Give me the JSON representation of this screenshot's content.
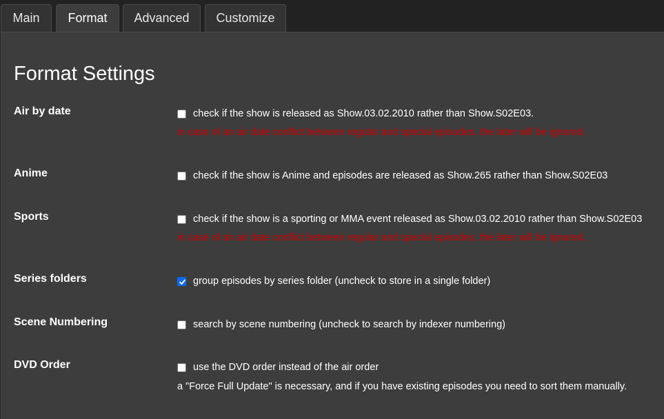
{
  "tabs": [
    {
      "label": "Main",
      "active": false
    },
    {
      "label": "Format",
      "active": true
    },
    {
      "label": "Advanced",
      "active": false
    },
    {
      "label": "Customize",
      "active": false
    }
  ],
  "title": "Format Settings",
  "settings": [
    {
      "label": "Air by date",
      "checked": false,
      "text": "check if the show is released as Show.03.02.2010 rather than Show.S02E03.",
      "warning": "in case of an air date conflict between regular and special episodes, the later will be ignored."
    },
    {
      "label": "Anime",
      "checked": false,
      "text": "check if the show is Anime and episodes are released as Show.265 rather than Show.S02E03"
    },
    {
      "label": "Sports",
      "checked": false,
      "text": "check if the show is a sporting or MMA event released as Show.03.02.2010 rather than Show.S02E03",
      "warning": "in case of an air date conflict between regular and special episodes, the later will be ignored."
    },
    {
      "label": "Series folders",
      "checked": true,
      "text": "group episodes by series folder (uncheck to store in a single folder)"
    },
    {
      "label": "Scene Numbering",
      "checked": false,
      "text": "search by scene numbering (uncheck to search by indexer numbering)"
    },
    {
      "label": "DVD Order",
      "checked": false,
      "text": "use the DVD order instead of the air order",
      "note": "a \"Force Full Update\" is necessary, and if you have existing episodes you need to sort them manually."
    }
  ],
  "colors": {
    "background": "#222222",
    "panel": "#3d3d3d",
    "warning": "#d20000",
    "checkbox_checked": "#0b6bf2"
  }
}
